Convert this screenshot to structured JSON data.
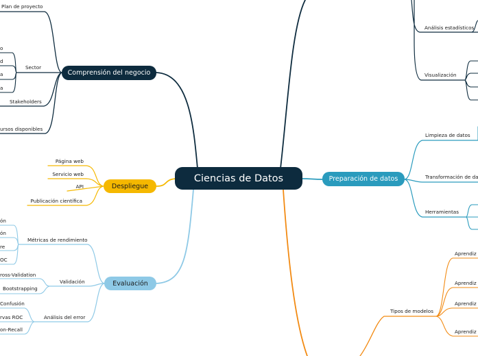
{
  "center": "Ciencias de Datos",
  "branches": {
    "comprension": {
      "title": "Comprensión del negocio",
      "items": [
        "Plan de proyecto",
        "o",
        "d",
        "a",
        "a",
        "Sector",
        "Stakeholders",
        "ursos disponibles"
      ]
    },
    "despliegue": {
      "title": "Despliegue",
      "items": [
        "Página web",
        "Servicio web",
        "API",
        "Publicación científica"
      ]
    },
    "evaluacion": {
      "title": "Evaluación",
      "items": [
        "ón",
        "ón",
        "re",
        "OC",
        "Métricas de rendimiento",
        "ross-Validation",
        "Bootstrapping",
        "Validación",
        "Confusión",
        "rvas ROC",
        "on-Recall",
        "Análisis del error"
      ]
    },
    "preparacion": {
      "title": "Preparación de datos",
      "items": [
        "Limpieza de datos",
        "Transformación de dat",
        "Herramientas"
      ]
    },
    "right_top": {
      "items": [
        "Análisis estadísticos",
        "Visualización"
      ]
    },
    "modelado": {
      "items": [
        "Tipos de modelos",
        "Aprendiz",
        "Aprendiz",
        "Aprendiz",
        "Aprendiz"
      ]
    }
  },
  "colors": {
    "dark": "#0d2b3e",
    "teal": "#2a9bbd",
    "yellow": "#f5b800",
    "lightblue": "#8ec9e6",
    "orange": "#f28a12"
  }
}
